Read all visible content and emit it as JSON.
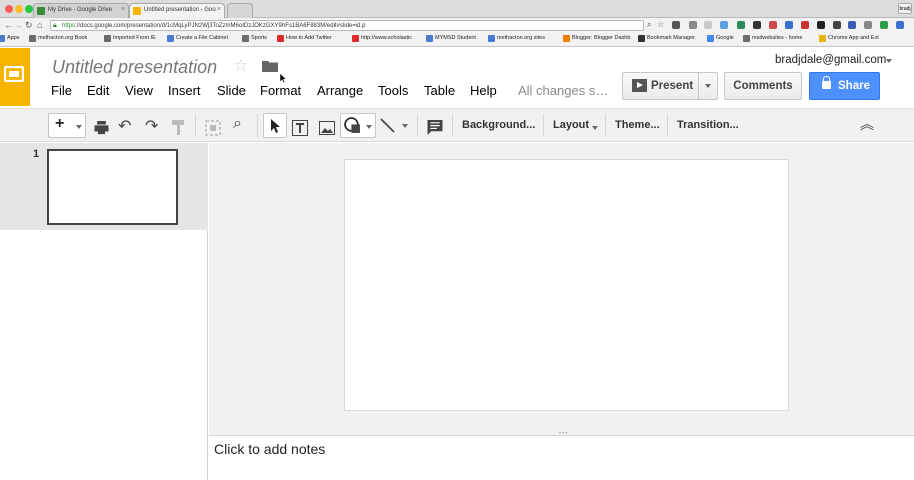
{
  "browser": {
    "tabs": [
      {
        "label": "My Drive - Google Drive",
        "active": false
      },
      {
        "label": "Untitled presentation - Goo",
        "active": true
      }
    ],
    "profile_label": "bradj",
    "url_scheme": "https",
    "url_rest": "://docs.google.com/presentation/d/1cMqLyPJN2Wj3ToZzmM6oIDzJOKzGXY9hFs1BA6F883M/edit#slide=id.p",
    "bookmarks": [
      {
        "label": "Apps",
        "color": "#4a7bd0"
      },
      {
        "label": "methacton.org Book",
        "color": "#6b6b6b"
      },
      {
        "label": "Imported From IE",
        "color": "#6b6b6b"
      },
      {
        "label": "Create a File Cabinet",
        "color": "#4a7bd0"
      },
      {
        "label": "Sports",
        "color": "#6b6b6b"
      },
      {
        "label": "How to Add Twitter",
        "color": "#dd2b2b"
      },
      {
        "label": "http://www.scholastic",
        "color": "#dd2b2b"
      },
      {
        "label": "MYMSD Student",
        "color": "#4a7bd0"
      },
      {
        "label": "methacton.org sites",
        "color": "#4a7bd0"
      },
      {
        "label": "Blogger: Blogger Dashb",
        "color": "#f57d00"
      },
      {
        "label": "Bookmark Manager",
        "color": "#333333"
      },
      {
        "label": "Google",
        "color": "#4285f4"
      },
      {
        "label": "msdwebsites - home",
        "color": "#6b6b6b"
      },
      {
        "label": "Chrome App and Ext",
        "color": "#e8b400"
      }
    ]
  },
  "header": {
    "title": "Untitled presentation",
    "account": "bradjdale@gmail.com",
    "menu": [
      "File",
      "Edit",
      "View",
      "Insert",
      "Slide",
      "Format",
      "Arrange",
      "Tools",
      "Table",
      "Help"
    ],
    "save_status": "All changes s…",
    "present_label": "Present",
    "comments_label": "Comments",
    "share_label": "Share",
    "logo_color": "#f4b400",
    "share_color": "#4d90fe"
  },
  "toolbar": {
    "text_buttons": [
      "Background...",
      "Layout",
      "Theme...",
      "Transition..."
    ]
  },
  "filmstrip": {
    "slides": [
      {
        "number": "1"
      }
    ]
  },
  "notes": {
    "placeholder": "Click to add notes"
  }
}
